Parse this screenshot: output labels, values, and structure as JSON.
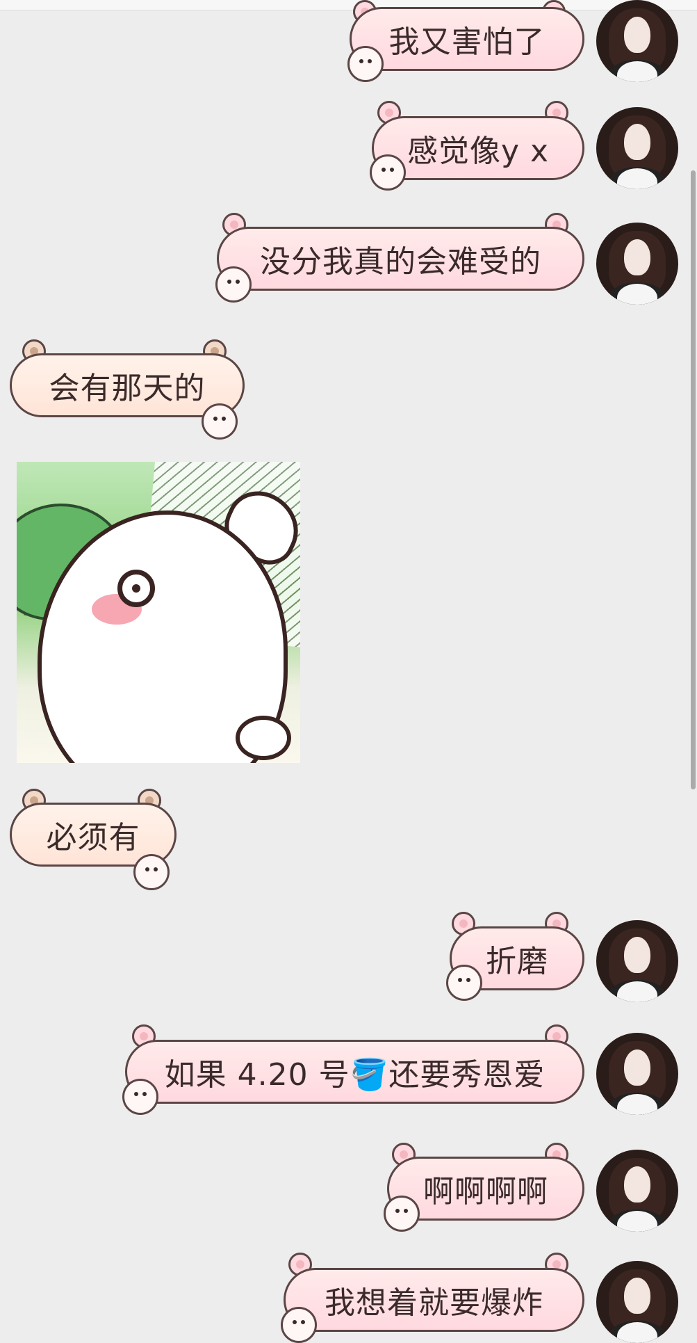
{
  "messages": [
    {
      "side": "right",
      "text": "我又害怕了"
    },
    {
      "side": "right",
      "text": "感觉像y x"
    },
    {
      "side": "right",
      "text": "没分我真的会难受的"
    },
    {
      "side": "left",
      "text": "会有那天的"
    },
    {
      "side": "left",
      "type": "image",
      "alt": "sticker image"
    },
    {
      "side": "left",
      "text": "必须有"
    },
    {
      "side": "right",
      "text": "折磨"
    },
    {
      "side": "right",
      "text": "如果 4.20 号🪣还要秀恩爱"
    },
    {
      "side": "right",
      "text": "啊啊啊啊"
    },
    {
      "side": "right",
      "text": "我想着就要爆炸"
    }
  ]
}
